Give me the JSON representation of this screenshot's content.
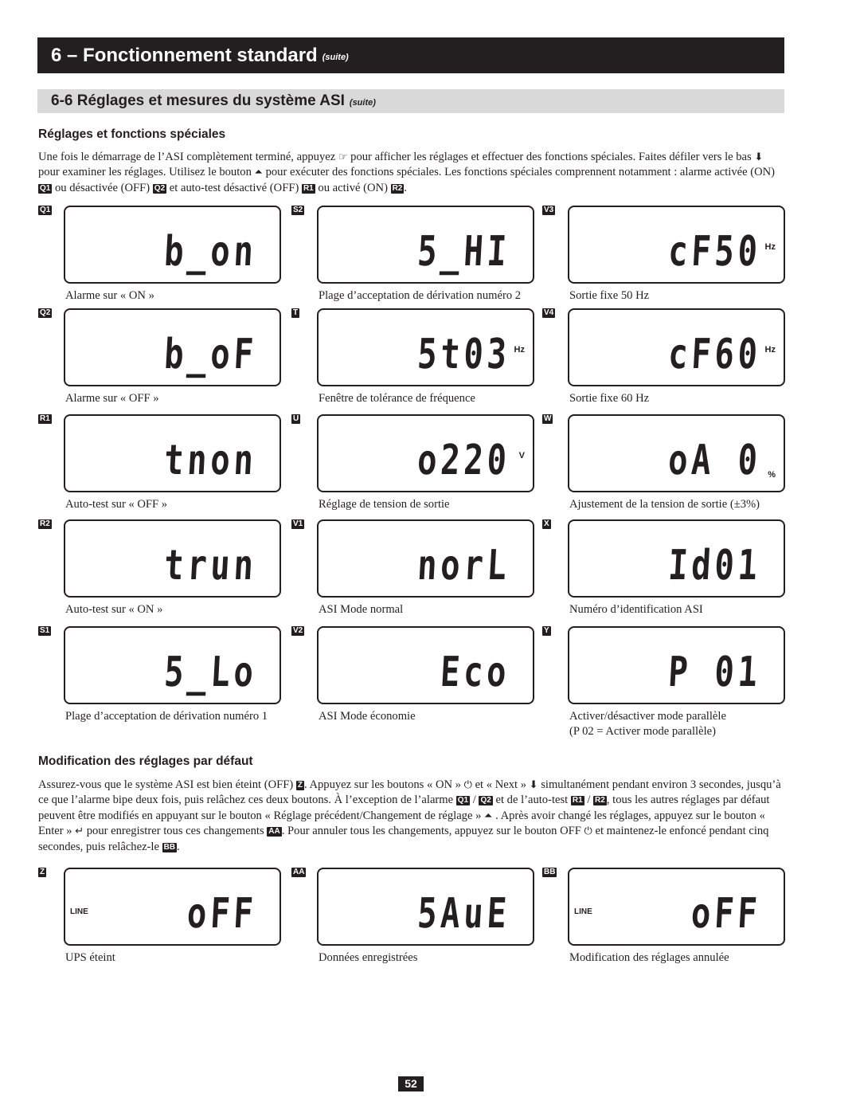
{
  "header": {
    "title": "6 – Fonctionnement standard",
    "suite": "(suite)"
  },
  "subheader": {
    "title": "6-6 Réglages et mesures du système ASI",
    "suite": "(suite)"
  },
  "section1": {
    "heading": "Réglages et fonctions spéciales",
    "p1": "Une fois le démarrage de l’ASI complètement terminé, appuyez ",
    "p2": " pour afficher les réglages et effectuer des fonctions spéciales. Faites défiler vers le bas ",
    "p3": " pour examiner les réglages. Utilisez le bouton ",
    "p4": " pour exécuter des fonctions spéciales. Les fonctions spéciales comprennent notamment : alarme activée (ON) ",
    "p5": " ou désactivée (OFF) ",
    "p6": " et auto-test désactivé (OFF) ",
    "p7": " ou activé (ON) ",
    "p8": "."
  },
  "icons": {
    "hand": "☞",
    "down": "⬇",
    "up": "⏶",
    "on": "⏻",
    "enter": "↵",
    "off": "⏻"
  },
  "tags": {
    "q1": "Q1",
    "q2": "Q2",
    "r1": "R1",
    "r2": "R2",
    "z": "Z",
    "aa": "AA",
    "bb": "BB"
  },
  "panels": [
    {
      "tag": "Q1",
      "display": "b_on",
      "unit": "",
      "caption": "Alarme sur « ON »"
    },
    {
      "tag": "S2",
      "display": "5_HI",
      "unit": "",
      "caption": "Plage d’acceptation de dérivation numéro 2"
    },
    {
      "tag": "V3",
      "display": "cF50",
      "unit": "Hz",
      "caption": "Sortie fixe 50 Hz"
    },
    {
      "tag": "Q2",
      "display": "b_oF",
      "unit": "",
      "caption": "Alarme sur « OFF »"
    },
    {
      "tag": "T",
      "display": "5t03",
      "unit": "Hz",
      "caption": "Fenêtre de tolérance de fréquence"
    },
    {
      "tag": "V4",
      "display": "cF60",
      "unit": "Hz",
      "caption": "Sortie fixe 60 Hz"
    },
    {
      "tag": "R1",
      "display": "tnon",
      "unit": "",
      "caption": "Auto-test sur « OFF »"
    },
    {
      "tag": "U",
      "display": "o220",
      "unit": "V",
      "caption": "Réglage de tension de sortie"
    },
    {
      "tag": "W",
      "display": "oA 0",
      "unit": "%",
      "caption": "Ajustement de la tension de sortie (±3%)"
    },
    {
      "tag": "R2",
      "display": "trun",
      "unit": "",
      "caption": "Auto-test sur « ON »"
    },
    {
      "tag": "V1",
      "display": "norL",
      "unit": "",
      "caption": "ASI Mode normal"
    },
    {
      "tag": "X",
      "display": "Id01",
      "unit": "",
      "caption": "Numéro d’identification ASI"
    },
    {
      "tag": "S1",
      "display": "5_Lo",
      "unit": "",
      "caption": "Plage d’acceptation de dérivation numéro 1"
    },
    {
      "tag": "V2",
      "display": "Eco",
      "unit": "",
      "caption": "ASI Mode économie"
    },
    {
      "tag": "Y",
      "display": "P 01",
      "unit": "",
      "caption": "Activer/désactiver mode parallèle",
      "caption2": "(P 02 = Activer mode parallèle)"
    }
  ],
  "section2": {
    "heading": "Modification des réglages par défaut",
    "p1": "Assurez-vous que le système ASI est bien éteint (OFF) ",
    "p2": ". Appuyez sur les boutons « ON » ",
    "p3": " et « Next » ",
    "p4": " simultanément pendant environ 3 secondes, jusqu’à ce que l’alarme bipe deux fois, puis relâchez ces deux boutons. À l’exception de l’alarme ",
    "p5": " / ",
    "p6": "  et de l’auto-test ",
    "p7": " / ",
    "p8": ", tous les autres réglages par défaut peuvent être modifiés en appuyant sur le bouton « Réglage précédent/Changement de réglage » ",
    "p9": " . Après avoir changé les réglages, appuyez sur le bouton « Enter » ",
    "p10": " pour enregistrer tous ces changements ",
    "p11": ". Pour annuler tous les changements, appuyez sur le bouton OFF ",
    "p12": " et maintenez-le enfoncé pendant cinq secondes, puis relâchez-le ",
    "p13": "."
  },
  "bottom_panels": [
    {
      "tag": "Z",
      "display": "oFF",
      "line_label": "LINE",
      "caption": "UPS éteint"
    },
    {
      "tag": "AA",
      "display": "5AuE",
      "line_label": "",
      "caption": "Données enregistrées"
    },
    {
      "tag": "BB",
      "display": "oFF",
      "line_label": "LINE",
      "caption": "Modification des réglages annulée"
    }
  ],
  "page_number": "52"
}
